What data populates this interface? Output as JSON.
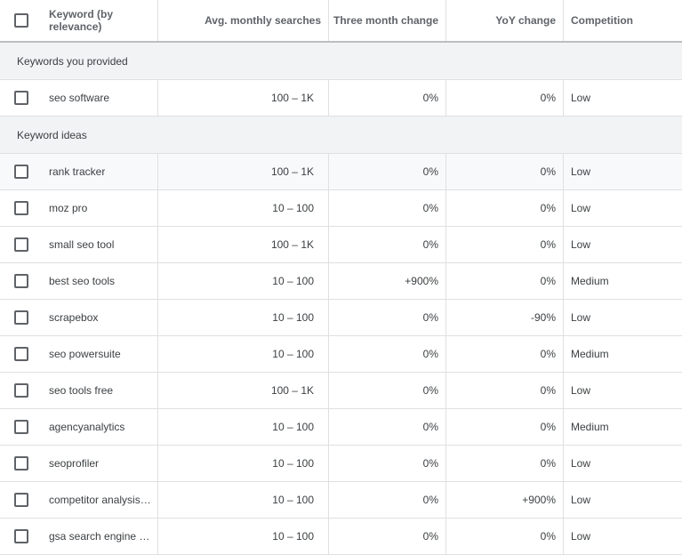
{
  "header": {
    "keyword": "Keyword (by relevance)",
    "avg_monthly": "Avg. monthly searches",
    "three_month": "Three month change",
    "yoy": "YoY change",
    "competition": "Competition"
  },
  "sections": {
    "provided_label": "Keywords you provided",
    "ideas_label": "Keyword ideas"
  },
  "provided": [
    {
      "keyword": "seo software",
      "avg": "100 – 1K",
      "three": "0%",
      "yoy": "0%",
      "competition": "Low"
    }
  ],
  "ideas": [
    {
      "keyword": "rank tracker",
      "avg": "100 – 1K",
      "three": "0%",
      "yoy": "0%",
      "competition": "Low"
    },
    {
      "keyword": "moz pro",
      "avg": "10 – 100",
      "three": "0%",
      "yoy": "0%",
      "competition": "Low"
    },
    {
      "keyword": "small seo tool",
      "avg": "100 – 1K",
      "three": "0%",
      "yoy": "0%",
      "competition": "Low"
    },
    {
      "keyword": "best seo tools",
      "avg": "10 – 100",
      "three": "+900%",
      "yoy": "0%",
      "competition": "Medium"
    },
    {
      "keyword": "scrapebox",
      "avg": "10 – 100",
      "three": "0%",
      "yoy": "-90%",
      "competition": "Low"
    },
    {
      "keyword": "seo powersuite",
      "avg": "10 – 100",
      "three": "0%",
      "yoy": "0%",
      "competition": "Medium"
    },
    {
      "keyword": "seo tools free",
      "avg": "100 – 1K",
      "three": "0%",
      "yoy": "0%",
      "competition": "Low"
    },
    {
      "keyword": "agencyanalytics",
      "avg": "10 – 100",
      "three": "0%",
      "yoy": "0%",
      "competition": "Medium"
    },
    {
      "keyword": "seoprofiler",
      "avg": "10 – 100",
      "three": "0%",
      "yoy": "0%",
      "competition": "Low"
    },
    {
      "keyword": "competitor analysis…",
      "avg": "10 – 100",
      "three": "0%",
      "yoy": "+900%",
      "competition": "Low"
    },
    {
      "keyword": "gsa search engine r…",
      "avg": "10 – 100",
      "three": "0%",
      "yoy": "0%",
      "competition": "Low"
    }
  ]
}
